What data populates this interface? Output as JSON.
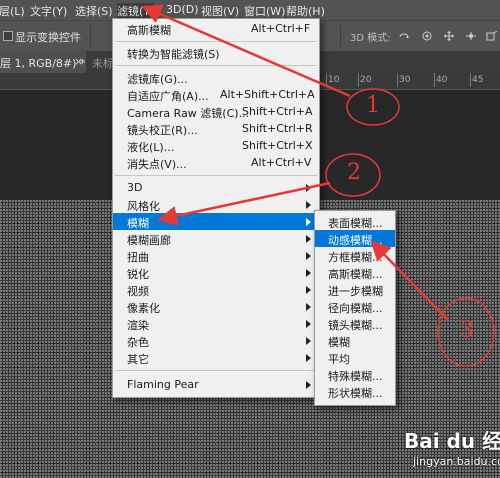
{
  "menubar": {
    "items": [
      {
        "label": "层(L)"
      },
      {
        "label": "文字(Y)"
      },
      {
        "label": "选择(S)"
      },
      {
        "label": "滤镜(T)"
      },
      {
        "label": "3D(D)"
      },
      {
        "label": "视图(V)"
      },
      {
        "label": "窗口(W)"
      },
      {
        "label": "帮助(H)"
      }
    ]
  },
  "options": {
    "transform_label": "显示变换控件",
    "mode_label": "3D 模式:"
  },
  "tabs": {
    "active": "层 1, RGB/8#) *",
    "close": "×",
    "inactive": "未标"
  },
  "ruler": {
    "ticks": [
      "10",
      "20",
      "30",
      "40",
      "45"
    ]
  },
  "filter_menu": {
    "items": [
      {
        "label": "高斯模糊",
        "shortcut": "Alt+Ctrl+F"
      },
      {
        "label": "转换为智能滤镜(S)",
        "shortcut": ""
      },
      {
        "label": "滤镜库(G)...",
        "shortcut": ""
      },
      {
        "label": "自适应广角(A)...",
        "shortcut": "Alt+Shift+Ctrl+A"
      },
      {
        "label": "Camera Raw 滤镜(C)...",
        "shortcut": "Shift+Ctrl+A"
      },
      {
        "label": "镜头校正(R)...",
        "shortcut": "Shift+Ctrl+R"
      },
      {
        "label": "液化(L)...",
        "shortcut": "Shift+Ctrl+X"
      },
      {
        "label": "消失点(V)...",
        "shortcut": "Alt+Ctrl+V"
      },
      {
        "label": "3D",
        "shortcut": ""
      },
      {
        "label": "风格化",
        "shortcut": ""
      },
      {
        "label": "模糊",
        "shortcut": ""
      },
      {
        "label": "模糊画廊",
        "shortcut": ""
      },
      {
        "label": "扭曲",
        "shortcut": ""
      },
      {
        "label": "锐化",
        "shortcut": ""
      },
      {
        "label": "视频",
        "shortcut": ""
      },
      {
        "label": "像素化",
        "shortcut": ""
      },
      {
        "label": "渲染",
        "shortcut": ""
      },
      {
        "label": "杂色",
        "shortcut": ""
      },
      {
        "label": "其它",
        "shortcut": ""
      },
      {
        "label": "Flaming Pear",
        "shortcut": ""
      }
    ]
  },
  "blur_submenu": {
    "items": [
      {
        "label": "表面模糊..."
      },
      {
        "label": "动感模糊..."
      },
      {
        "label": "方框模糊..."
      },
      {
        "label": "高斯模糊..."
      },
      {
        "label": "进一步模糊"
      },
      {
        "label": "径向模糊..."
      },
      {
        "label": "镜头模糊..."
      },
      {
        "label": "模糊"
      },
      {
        "label": "平均"
      },
      {
        "label": "特殊模糊..."
      },
      {
        "label": "形状模糊..."
      }
    ]
  },
  "annotations": {
    "one": "1",
    "two": "2",
    "three": "3",
    "color": "#e53935"
  },
  "watermark": {
    "brand": "Bai du 经验",
    "url": "jingyan.baidu.com"
  }
}
